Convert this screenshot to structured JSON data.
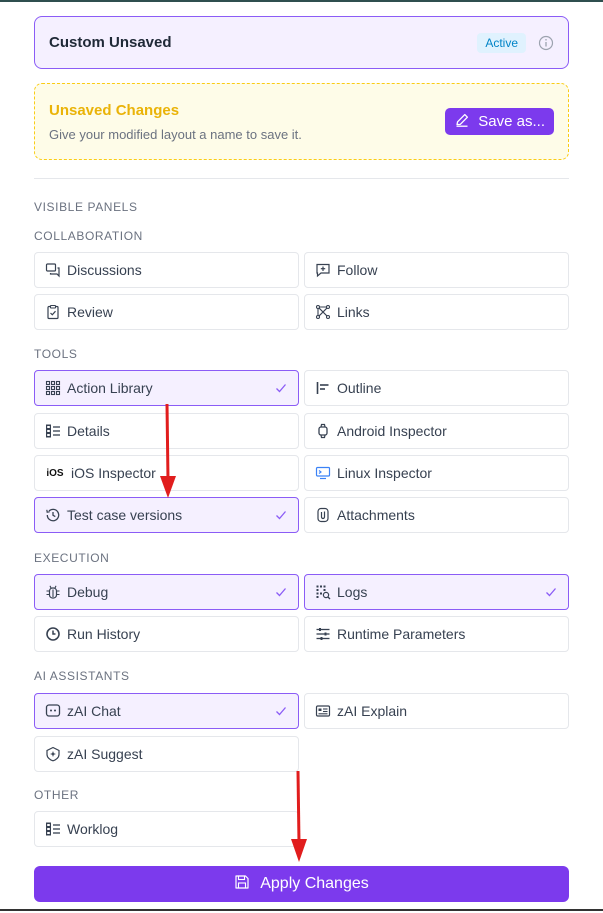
{
  "profile": {
    "title": "Custom Unsaved",
    "badge": "Active"
  },
  "unsaved": {
    "title": "Unsaved Changes",
    "subtitle": "Give your modified layout a name to save it.",
    "save_label": "Save as..."
  },
  "sections": {
    "visible_panels": "VISIBLE PANELS",
    "collaboration": "COLLABORATION",
    "tools": "TOOLS",
    "execution": "EXECUTION",
    "ai_assistants": "AI ASSISTANTS",
    "other": "OTHER"
  },
  "panels": {
    "discussions": {
      "label": "Discussions",
      "selected": false
    },
    "follow": {
      "label": "Follow",
      "selected": false
    },
    "review": {
      "label": "Review",
      "selected": false
    },
    "links": {
      "label": "Links",
      "selected": false
    },
    "action_library": {
      "label": "Action Library",
      "selected": true
    },
    "outline": {
      "label": "Outline",
      "selected": false
    },
    "details": {
      "label": "Details",
      "selected": false
    },
    "android_inspector": {
      "label": "Android Inspector",
      "selected": false
    },
    "ios_inspector": {
      "label": "iOS Inspector",
      "selected": false,
      "icon_text": "iOS"
    },
    "linux_inspector": {
      "label": "Linux Inspector",
      "selected": false
    },
    "test_case_versions": {
      "label": "Test case versions",
      "selected": true
    },
    "attachments": {
      "label": "Attachments",
      "selected": false
    },
    "debug": {
      "label": "Debug",
      "selected": true
    },
    "logs": {
      "label": "Logs",
      "selected": true
    },
    "run_history": {
      "label": "Run History",
      "selected": false
    },
    "runtime_parameters": {
      "label": "Runtime Parameters",
      "selected": false
    },
    "zai_chat": {
      "label": "zAI Chat",
      "selected": true
    },
    "zai_explain": {
      "label": "zAI Explain",
      "selected": false
    },
    "zai_suggest": {
      "label": "zAI Suggest",
      "selected": false
    },
    "worklog": {
      "label": "Worklog",
      "selected": false
    }
  },
  "apply": {
    "label": "Apply Changes"
  },
  "colors": {
    "accent": "#7c3aed",
    "selected_border": "#8b5cf6",
    "selected_bg": "#f5f0ff",
    "warning": "#eab308",
    "annotation_arrow": "#e11d1d"
  }
}
